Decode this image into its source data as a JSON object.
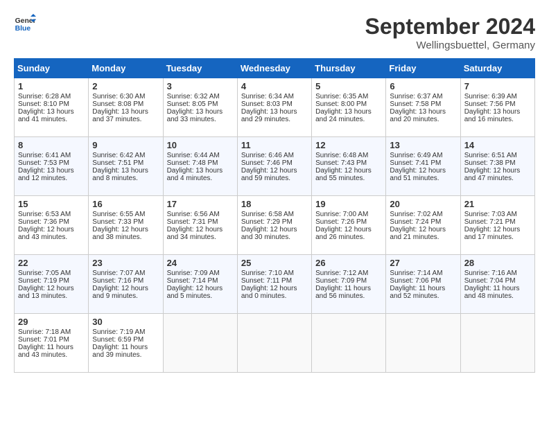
{
  "logo": {
    "line1": "General",
    "line2": "Blue"
  },
  "title": "September 2024",
  "location": "Wellingsbuettel, Germany",
  "days_of_week": [
    "Sunday",
    "Monday",
    "Tuesday",
    "Wednesday",
    "Thursday",
    "Friday",
    "Saturday"
  ],
  "weeks": [
    [
      {
        "day": 1,
        "sunrise": "6:28 AM",
        "sunset": "8:10 PM",
        "daylight": "13 hours and 41 minutes."
      },
      {
        "day": 2,
        "sunrise": "6:30 AM",
        "sunset": "8:08 PM",
        "daylight": "13 hours and 37 minutes."
      },
      {
        "day": 3,
        "sunrise": "6:32 AM",
        "sunset": "8:05 PM",
        "daylight": "13 hours and 33 minutes."
      },
      {
        "day": 4,
        "sunrise": "6:34 AM",
        "sunset": "8:03 PM",
        "daylight": "13 hours and 29 minutes."
      },
      {
        "day": 5,
        "sunrise": "6:35 AM",
        "sunset": "8:00 PM",
        "daylight": "13 hours and 24 minutes."
      },
      {
        "day": 6,
        "sunrise": "6:37 AM",
        "sunset": "7:58 PM",
        "daylight": "13 hours and 20 minutes."
      },
      {
        "day": 7,
        "sunrise": "6:39 AM",
        "sunset": "7:56 PM",
        "daylight": "13 hours and 16 minutes."
      }
    ],
    [
      {
        "day": 8,
        "sunrise": "6:41 AM",
        "sunset": "7:53 PM",
        "daylight": "13 hours and 12 minutes."
      },
      {
        "day": 9,
        "sunrise": "6:42 AM",
        "sunset": "7:51 PM",
        "daylight": "13 hours and 8 minutes."
      },
      {
        "day": 10,
        "sunrise": "6:44 AM",
        "sunset": "7:48 PM",
        "daylight": "13 hours and 4 minutes."
      },
      {
        "day": 11,
        "sunrise": "6:46 AM",
        "sunset": "7:46 PM",
        "daylight": "12 hours and 59 minutes."
      },
      {
        "day": 12,
        "sunrise": "6:48 AM",
        "sunset": "7:43 PM",
        "daylight": "12 hours and 55 minutes."
      },
      {
        "day": 13,
        "sunrise": "6:49 AM",
        "sunset": "7:41 PM",
        "daylight": "12 hours and 51 minutes."
      },
      {
        "day": 14,
        "sunrise": "6:51 AM",
        "sunset": "7:38 PM",
        "daylight": "12 hours and 47 minutes."
      }
    ],
    [
      {
        "day": 15,
        "sunrise": "6:53 AM",
        "sunset": "7:36 PM",
        "daylight": "12 hours and 43 minutes."
      },
      {
        "day": 16,
        "sunrise": "6:55 AM",
        "sunset": "7:33 PM",
        "daylight": "12 hours and 38 minutes."
      },
      {
        "day": 17,
        "sunrise": "6:56 AM",
        "sunset": "7:31 PM",
        "daylight": "12 hours and 34 minutes."
      },
      {
        "day": 18,
        "sunrise": "6:58 AM",
        "sunset": "7:29 PM",
        "daylight": "12 hours and 30 minutes."
      },
      {
        "day": 19,
        "sunrise": "7:00 AM",
        "sunset": "7:26 PM",
        "daylight": "12 hours and 26 minutes."
      },
      {
        "day": 20,
        "sunrise": "7:02 AM",
        "sunset": "7:24 PM",
        "daylight": "12 hours and 21 minutes."
      },
      {
        "day": 21,
        "sunrise": "7:03 AM",
        "sunset": "7:21 PM",
        "daylight": "12 hours and 17 minutes."
      }
    ],
    [
      {
        "day": 22,
        "sunrise": "7:05 AM",
        "sunset": "7:19 PM",
        "daylight": "12 hours and 13 minutes."
      },
      {
        "day": 23,
        "sunrise": "7:07 AM",
        "sunset": "7:16 PM",
        "daylight": "12 hours and 9 minutes."
      },
      {
        "day": 24,
        "sunrise": "7:09 AM",
        "sunset": "7:14 PM",
        "daylight": "12 hours and 5 minutes."
      },
      {
        "day": 25,
        "sunrise": "7:10 AM",
        "sunset": "7:11 PM",
        "daylight": "12 hours and 0 minutes."
      },
      {
        "day": 26,
        "sunrise": "7:12 AM",
        "sunset": "7:09 PM",
        "daylight": "11 hours and 56 minutes."
      },
      {
        "day": 27,
        "sunrise": "7:14 AM",
        "sunset": "7:06 PM",
        "daylight": "11 hours and 52 minutes."
      },
      {
        "day": 28,
        "sunrise": "7:16 AM",
        "sunset": "7:04 PM",
        "daylight": "11 hours and 48 minutes."
      }
    ],
    [
      {
        "day": 29,
        "sunrise": "7:18 AM",
        "sunset": "7:01 PM",
        "daylight": "11 hours and 43 minutes."
      },
      {
        "day": 30,
        "sunrise": "7:19 AM",
        "sunset": "6:59 PM",
        "daylight": "11 hours and 39 minutes."
      },
      null,
      null,
      null,
      null,
      null
    ]
  ]
}
